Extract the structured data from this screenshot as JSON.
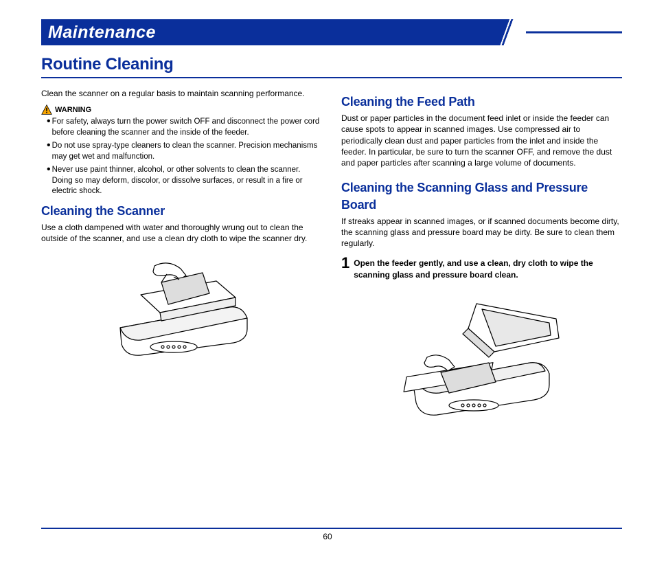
{
  "chapter_title": "Maintenance",
  "section_title": "Routine Cleaning",
  "page_number": "60",
  "left": {
    "intro": "Clean the scanner on a regular basis to maintain scanning performance.",
    "warning_label": "WARNING",
    "warnings": [
      "For safety, always turn the power switch OFF and disconnect the power cord before cleaning the scanner and the inside of the feeder.",
      "Do not use spray-type cleaners to clean the scanner. Precision mechanisms may get wet and malfunction.",
      "Never use paint thinner, alcohol, or other solvents to clean the scanner. Doing so may deform, discolor, or dissolve surfaces, or result in a fire or electric shock."
    ],
    "sub1_title": "Cleaning the Scanner",
    "sub1_body": "Use a cloth dampened with water and thoroughly wrung out to clean the outside of the scanner, and use a clean dry cloth to wipe the scanner dry."
  },
  "right": {
    "sub1_title": "Cleaning the Feed Path",
    "sub1_body": "Dust or paper particles in the document feed inlet or inside the feeder can cause spots to appear in scanned images. Use compressed air to periodically clean dust and paper particles from the inlet and inside the feeder. In particular, be sure to turn the scanner OFF, and remove the dust and paper particles after scanning a large volume of documents.",
    "sub2_title": "Cleaning the Scanning Glass and Pressure Board",
    "sub2_body": "If streaks appear in scanned images, or if scanned documents become dirty, the scanning glass and pressure board may be dirty. Be sure to clean them regularly.",
    "step_num": "1",
    "step_text": "Open the feeder gently, and use a clean, dry cloth to wipe the scanning glass and pressure board clean."
  }
}
